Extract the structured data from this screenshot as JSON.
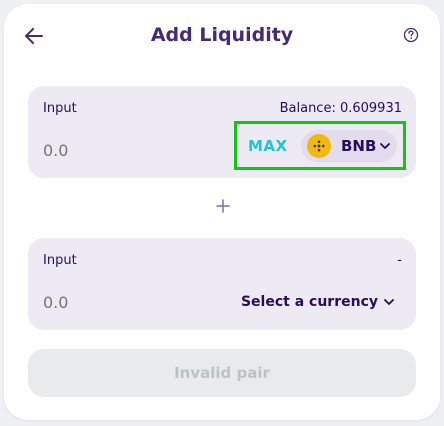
{
  "header": {
    "title": "Add Liquidity"
  },
  "input_a": {
    "label": "Input",
    "balance": "Balance: 0.609931",
    "amount_placeholder": "0.0",
    "max_label": "MAX",
    "currency": "BNB"
  },
  "input_b": {
    "label": "Input",
    "balance": "-",
    "amount_placeholder": "0.0",
    "select_label": "Select a currency"
  },
  "action": {
    "label": "Invalid pair"
  },
  "colors": {
    "brand_purple": "#280d5f",
    "accent_cyan": "#1fc7d4",
    "highlight_green": "#16c416",
    "bnb_yellow": "#f0b90b"
  },
  "icons": {
    "back": "arrow-left-icon",
    "help": "question-circle-icon",
    "plus": "plus-icon",
    "chevron": "chevron-down-icon",
    "bnb": "bnb-logo-icon"
  }
}
